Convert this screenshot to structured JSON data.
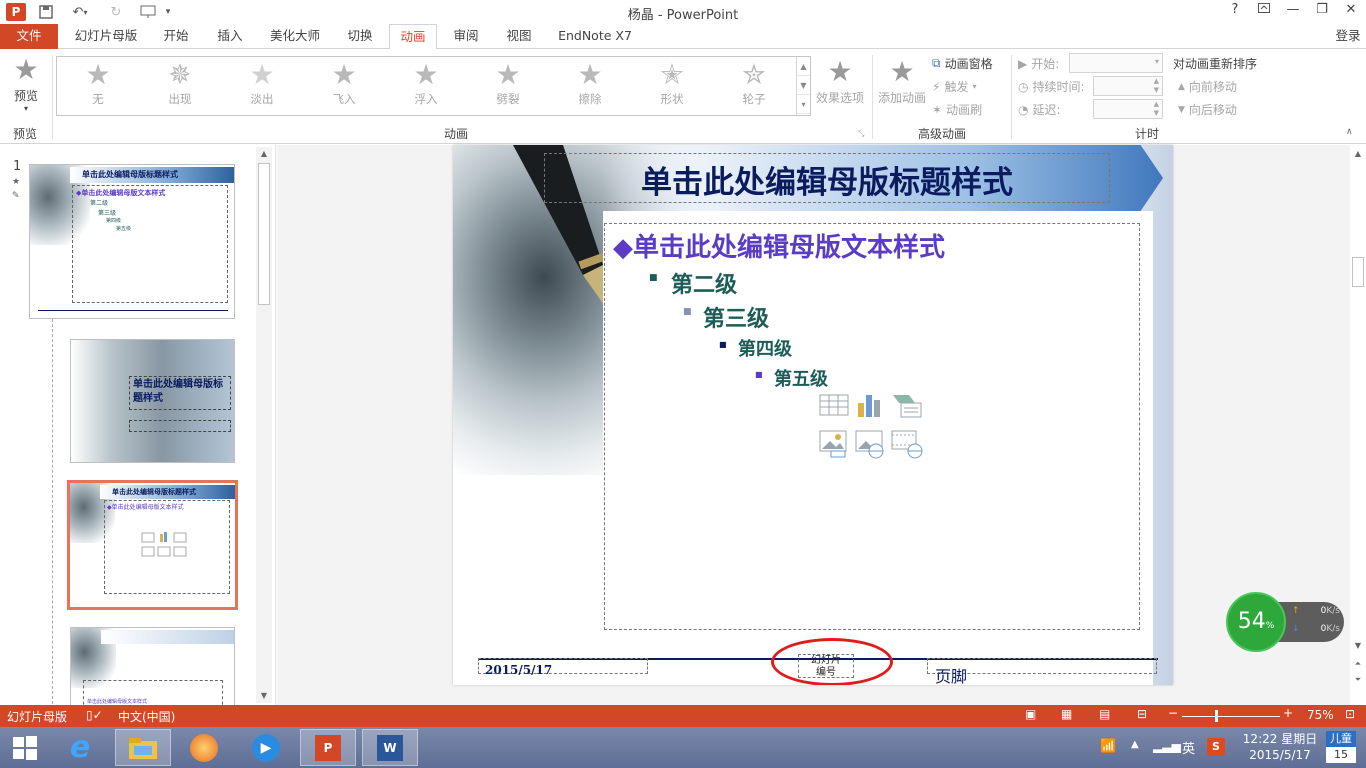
{
  "window": {
    "title": "杨晶 - PowerPoint",
    "help": "?",
    "signin": "登录"
  },
  "tabs": [
    "文件",
    "幻灯片母版",
    "开始",
    "插入",
    "美化大师",
    "切换",
    "动画",
    "审阅",
    "视图",
    "EndNote X7"
  ],
  "active_tab": "动画",
  "ribbon": {
    "preview_label": "预览",
    "preview_group": "预览",
    "animations": [
      "无",
      "出现",
      "淡出",
      "飞入",
      "浮入",
      "劈裂",
      "擦除",
      "形状",
      "轮子"
    ],
    "effect_options": "效果选项",
    "animation_group": "动画",
    "add_animation": "添加动画",
    "animation_pane": "动画窗格",
    "trigger": "触发",
    "animation_painter": "动画刷",
    "advanced_group": "高级动画",
    "start_label": "开始:",
    "duration_label": "持续时间:",
    "delay_label": "延迟:",
    "timing_group": "计时",
    "reorder_label": "对动画重新排序",
    "move_earlier": "向前移动",
    "move_later": "向后移动"
  },
  "thumbnails": {
    "slide_number": "1",
    "t1_title": "单击此处编辑母版标题样式",
    "t1_body": "◆单击此处编辑母版文本样式",
    "t1_l2": "第二级",
    "t1_l3": "第三级",
    "t1_l4": "第四级",
    "t1_l5": "第五级",
    "t2_title": "单击此处编辑母版标题样式",
    "t3_title": "单击此处编辑母版标题样式",
    "t3_body": "◆单击此处编辑母版文本样式",
    "t4_body": "单击此处编辑母版文本样式"
  },
  "slide": {
    "title": "单击此处编辑母版标题样式",
    "body_l1": "◆单击此处编辑母版文本样式",
    "body_l2": "第二级",
    "body_l3": "第三级",
    "body_l4": "第四级",
    "body_l5": "第五级",
    "date": "2015/5/17",
    "slide_number_line1": "幻灯片",
    "slide_number_line2": "编号",
    "footer": "页脚"
  },
  "statusbar": {
    "view": "幻灯片母版",
    "language": "中文(中国)",
    "zoom": "75%"
  },
  "net_widget": {
    "percent": "54",
    "unit": "%",
    "up": "0",
    "down": "0",
    "rate_unit": "K/s"
  },
  "taskbar": {
    "ime": "英",
    "time": "12:22 星期日",
    "date": "2015/5/17",
    "calendar_top": "儿童",
    "calendar_day": "15"
  },
  "colors": {
    "accent": "#d24726",
    "title_text": "#0b1c5e",
    "body_text": "#5b3cc4",
    "level_text": "#1d5d58"
  }
}
